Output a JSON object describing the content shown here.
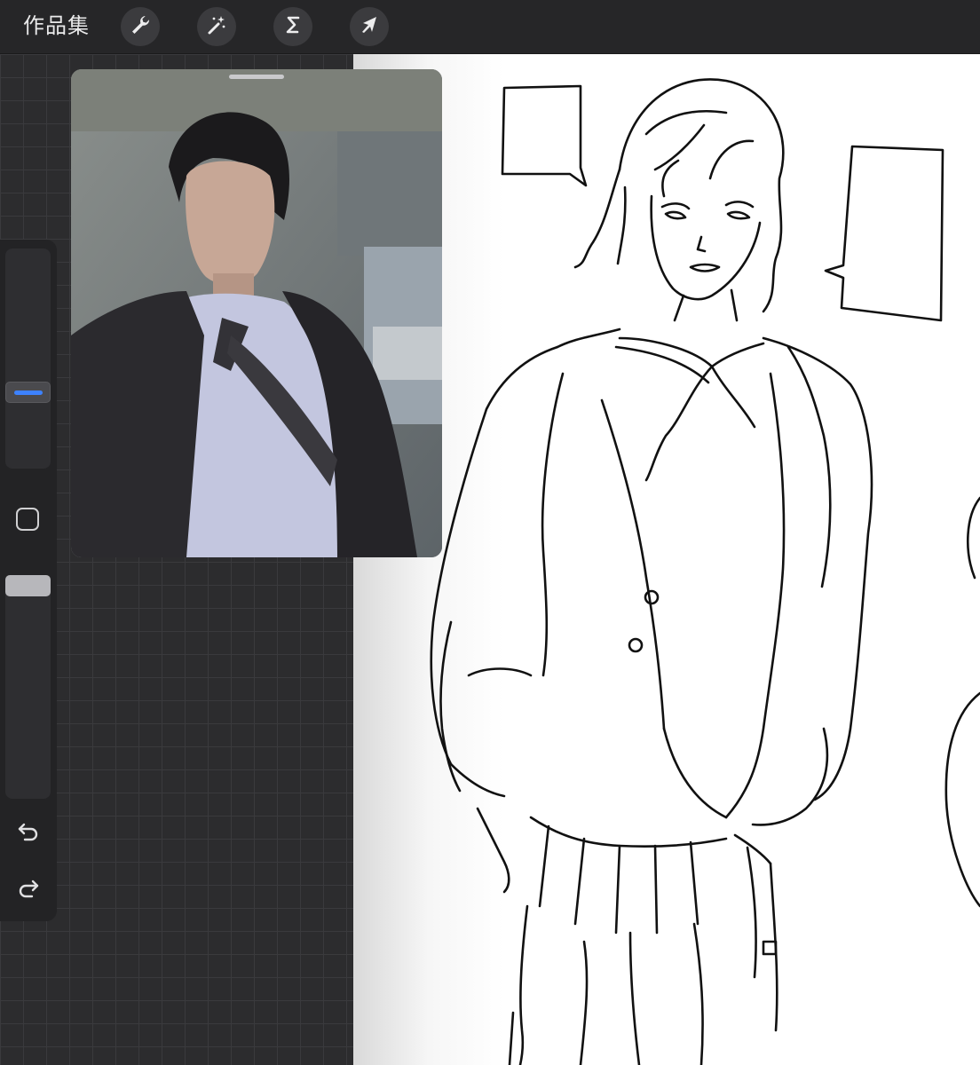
{
  "app": {
    "gallery_label": "作品集"
  },
  "toolbar": {
    "buttons": [
      {
        "name": "actions",
        "icon": "wrench-icon"
      },
      {
        "name": "adjustments",
        "icon": "magic-wand-icon"
      },
      {
        "name": "selection",
        "icon": "selection-s-icon"
      },
      {
        "name": "transform",
        "icon": "arrow-cursor-icon"
      }
    ]
  },
  "sidebar": {
    "brush_size_slider": {
      "value": 0.38
    },
    "opacity_slider": {
      "value": 1.0
    },
    "undo_icon": "undo-arrow-icon",
    "redo_icon": "redo-arrow-icon",
    "modify_icon": "square-outline-icon"
  },
  "reference_window": {
    "content": "photo-reference"
  },
  "colors": {
    "toolbar_bg": "#262628",
    "grid_bg": "#2c2c2e",
    "accent": "#3d82ff",
    "canvas_bg": "#ffffff"
  }
}
